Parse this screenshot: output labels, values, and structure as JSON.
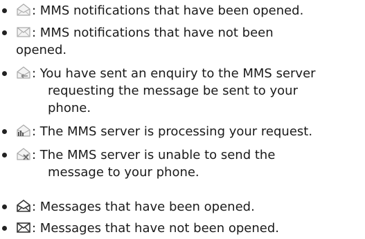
{
  "items": [
    {
      "icon": "mms-notification-opened-icon",
      "lines": [
        ": MMS notifications that have been opened."
      ]
    },
    {
      "icon": "mms-notification-unopened-icon",
      "lines": [
        " : MMS notifications that have not been",
        "opened."
      ]
    },
    {
      "icon": "mms-enquiry-sent-icon",
      "lines": [
        ": You have sent an enquiry to the MMS server",
        "requesting the message be sent to your",
        "phone."
      ]
    },
    {
      "icon": "mms-server-processing-icon",
      "lines": [
        ": The MMS server is processing your request."
      ]
    },
    {
      "icon": "mms-server-failed-icon",
      "lines": [
        ": The MMS server is unable to send the",
        "message to your phone."
      ]
    },
    {
      "icon": "message-opened-icon",
      "lines": [
        ": Messages that have been opened."
      ]
    },
    {
      "icon": "message-unopened-icon",
      "lines": [
        ": Messages that have not been opened."
      ]
    }
  ]
}
